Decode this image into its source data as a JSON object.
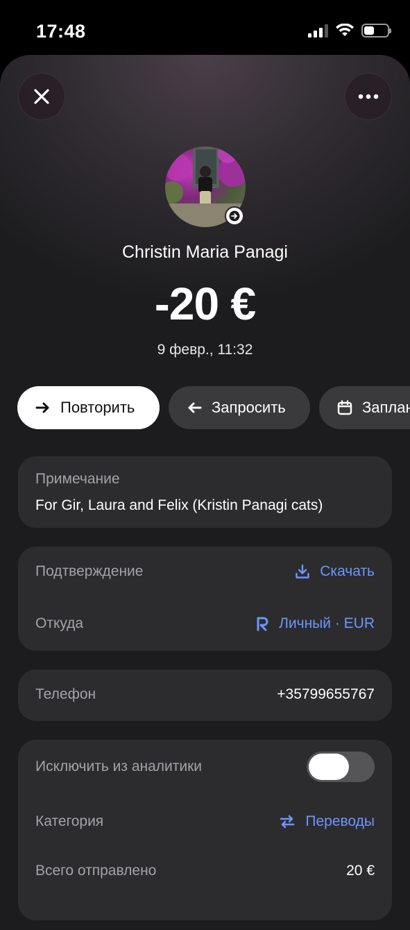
{
  "status_bar": {
    "time": "17:48"
  },
  "header": {
    "close_icon": "close-icon",
    "more_icon": "more-horizontal-icon"
  },
  "transaction": {
    "name": "Christin Maria Panagi",
    "amount": "-20 €",
    "date": "9 февр., 11:32"
  },
  "actions": {
    "repeat_label": "Повторить",
    "request_label": "Запросить",
    "schedule_label": "Заплан"
  },
  "note": {
    "label": "Примечание",
    "value": "For Gir, Laura and Felix (Kristin Panagi cats)"
  },
  "details": {
    "confirmation_label": "Подтверждение",
    "download_label": "Скачать",
    "from_label": "Откуда",
    "from_value": "Личный · EUR"
  },
  "phone": {
    "label": "Телефон",
    "value": "+35799655767"
  },
  "analytics": {
    "exclude_label": "Исключить из аналитики",
    "exclude_enabled": false,
    "category_label": "Категория",
    "category_value": "Переводы",
    "total_sent_label": "Всего отправлено",
    "total_sent_value": "20 €"
  },
  "colors": {
    "accent": "#6c96ff",
    "card_bg": "#2c2c2e",
    "sheet_bg": "#1c1c1e"
  }
}
